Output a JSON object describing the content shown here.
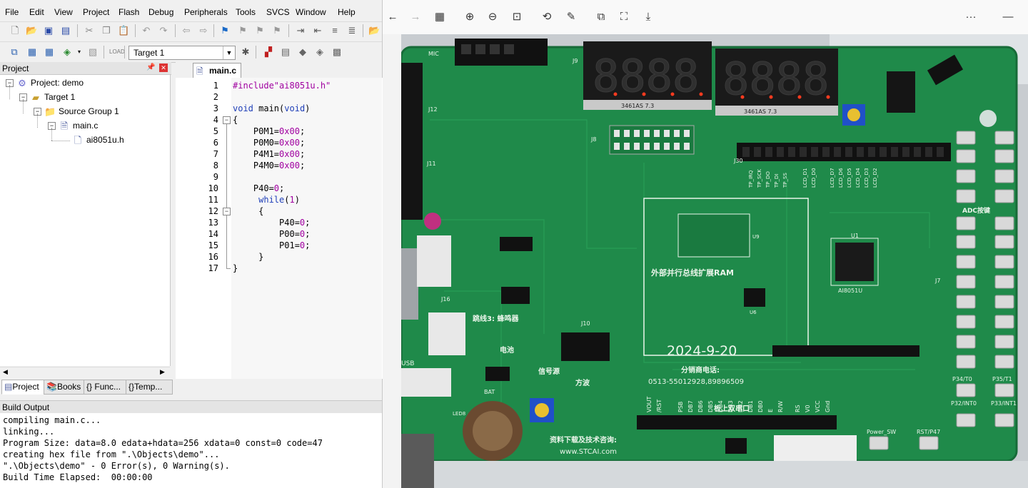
{
  "menu": [
    "File",
    "Edit",
    "View",
    "Project",
    "Flash",
    "Debug",
    "Peripherals",
    "Tools",
    "SVCS",
    "Window",
    "Help"
  ],
  "toolbar": {
    "target": "Target 1"
  },
  "project_pane": {
    "title": "Project",
    "tree": [
      {
        "label": "Project: demo"
      },
      {
        "label": "Target 1"
      },
      {
        "label": "Source Group 1"
      },
      {
        "label": "main.c"
      },
      {
        "label": "ai8051u.h"
      }
    ],
    "tabs": [
      "Project",
      "Books",
      "Func...",
      "Temp..."
    ]
  },
  "editor": {
    "tab": "main.c",
    "lines": [
      {
        "n": "1"
      },
      {
        "n": "2"
      },
      {
        "n": "3"
      },
      {
        "n": "4"
      },
      {
        "n": "5"
      },
      {
        "n": "6"
      },
      {
        "n": "7"
      },
      {
        "n": "8"
      },
      {
        "n": "9"
      },
      {
        "n": "10"
      },
      {
        "n": "11"
      },
      {
        "n": "12"
      },
      {
        "n": "13"
      },
      {
        "n": "14"
      },
      {
        "n": "15"
      },
      {
        "n": "16"
      },
      {
        "n": "17"
      }
    ],
    "code": {
      "include": "#include\"ai8051u.h\"",
      "void": "void",
      "main_sig": " main(",
      "void2": "void",
      "close_paren": ")",
      "brace_open": "{",
      "p0m1": "    P0M1=",
      "p0m0": "    P0M0=",
      "p4m1": "    P4M1=",
      "p4m0": "    P4M0=",
      "hex00": "0x00",
      "semi": ";",
      "p40": "    P40=",
      "zero": "0",
      "while": "while",
      "one": "1",
      "inner_open": "     {",
      "p40b": "         P40=",
      "p00": "         P00=",
      "p01": "         P01=",
      "inner_close": "     }",
      "brace_close": "}"
    }
  },
  "build_output": {
    "title": "Build Output",
    "lines": [
      "compiling main.c...",
      "linking...",
      "Program Size: data=8.0 edata+hdata=256 xdata=0 const=0 code=47",
      "creating hex file from \".\\Objects\\demo\"...",
      "\".\\Objects\\demo\" - 0 Error(s), 0 Warning(s).",
      "Build Time Elapsed:  00:00:00"
    ]
  },
  "viewer": {
    "more": "···",
    "minimize": "—"
  },
  "photo": {
    "date_silk": "2024-9-20",
    "chip_label": "AI8051U",
    "phone_label": "分销商电话:",
    "phone_numbers": "0513-55012928,89896509",
    "download_label": "资料下载及技术咨询:",
    "website": "www.STCAI.com",
    "ram_label": "外部并行总线扩展RAM",
    "seg_label_1": "3461AS 7.3",
    "seg_label_2": "3461AS 7.3",
    "adc_label": "ADC按键",
    "serial_label": "板上双串口",
    "power_sw": "Power_SW",
    "rst_label": "RST/P47",
    "bat_label": "BAT",
    "signal_label": "信号源",
    "square_label": "方波",
    "battery_label": "电池",
    "buzzer_label": "跳线3: 蜂鸣器",
    "p34": "P34/T0",
    "p35": "P35/T1",
    "p32": "P32/INT0",
    "p33": "P33/INT1",
    "mic": "MIC",
    "j12": "J12",
    "j11": "J11",
    "j9": "J9",
    "j8": "J8",
    "j10": "J10",
    "j30": "J30",
    "j7": "J7",
    "j16": "J16",
    "u1": "U1",
    "u6": "U6",
    "u9": "U9",
    "usb": "USB",
    "led8": "LED8",
    "pin_labels": [
      "TP_IRQ",
      "TP_SCK",
      "TP_DO",
      "TP_DI",
      "TP_SS",
      "LCD_D1",
      "LCD_D0",
      "LCD_D7",
      "LCD_D6",
      "LCD_D5",
      "LCD_D4",
      "LCD_D3",
      "LCD_D2"
    ],
    "bottom_pins": [
      "VOUT",
      "/RST",
      "PSB",
      "DB7",
      "DB6",
      "DB5",
      "DB4",
      "DB3",
      "DB2",
      "DB1",
      "DB0",
      "E",
      "R/W",
      "RS",
      "V0",
      "VCC",
      "Gnd"
    ]
  },
  "colors": {
    "pcb": "#1f8a4a",
    "pcb_dark": "#176b38",
    "seg_red": "#ff3b1f",
    "keyword": "#1f3fb8",
    "preproc": "#a000a0"
  }
}
